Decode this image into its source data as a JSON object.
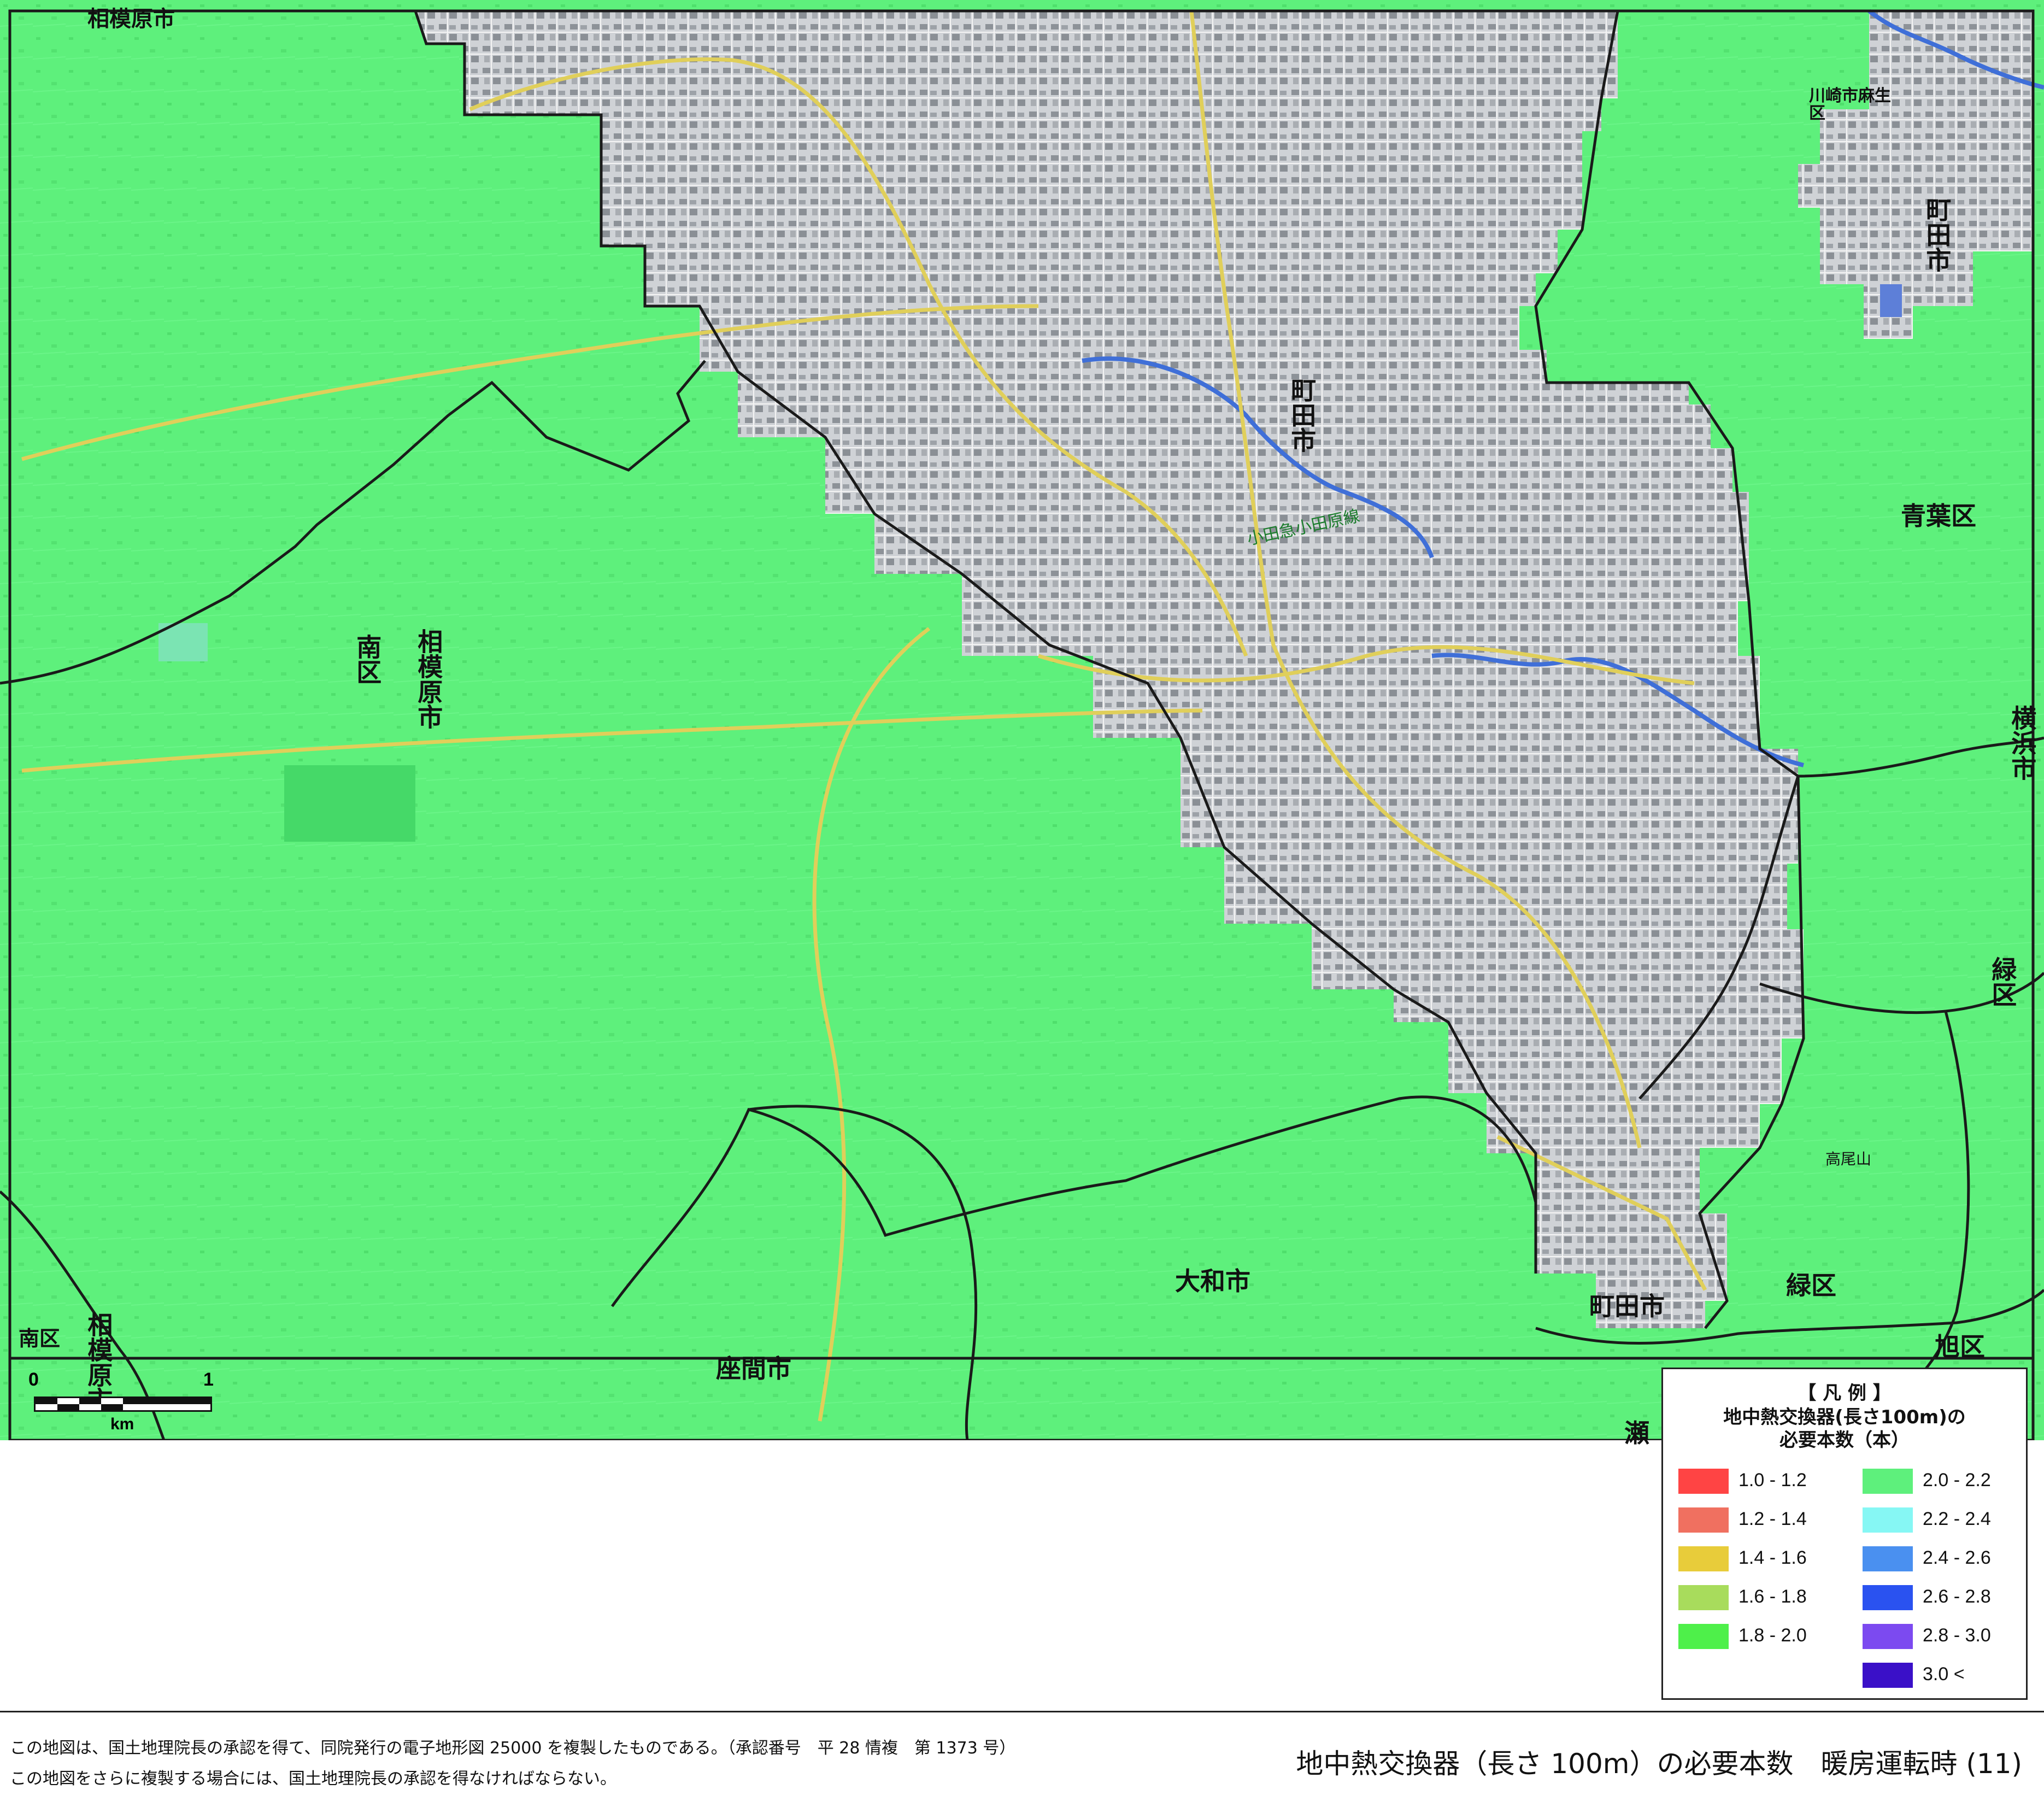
{
  "colors": {
    "green_band": "#5ef07c",
    "urban_gray": "#c9ccd0",
    "boundary": "#1a1a1a",
    "river": "#3f6fd8",
    "road": "#e0cf5a"
  },
  "map": {
    "place_labels": [
      {
        "text": "相模原市",
        "vertical": false
      },
      {
        "text": "町田市",
        "vertical": true
      },
      {
        "text": "川崎市麻生区",
        "vertical": false
      },
      {
        "text": "町田市",
        "vertical": true
      },
      {
        "text": "青葉区",
        "vertical": false
      },
      {
        "text": "横浜市",
        "vertical": true
      },
      {
        "text": "南区",
        "vertical": true
      },
      {
        "text": "相模原市",
        "vertical": true
      },
      {
        "text": "緑区",
        "vertical": true
      },
      {
        "text": "大和市",
        "vertical": false
      },
      {
        "text": "町田市",
        "vertical": false
      },
      {
        "text": "緑区",
        "vertical": false
      },
      {
        "text": "旭区",
        "vertical": false
      },
      {
        "text": "座間市",
        "vertical": false
      },
      {
        "text": "瀬",
        "vertical": false
      },
      {
        "text": "相模原市",
        "vertical": true
      },
      {
        "text": "南区",
        "vertical": false
      },
      {
        "text": "高尾山",
        "vertical": false
      }
    ],
    "route_label": "小田急小田原線"
  },
  "scale_bar": {
    "zero": "0",
    "one": "1",
    "unit": "km"
  },
  "legend": {
    "heading": "【 凡 例 】",
    "title_line1": "地中熱交換器(長さ100m)の",
    "title_line2": "必要本数（本）",
    "items": [
      {
        "label": "1.0 - 1.2",
        "color": "#ff4444"
      },
      {
        "label": "1.2 - 1.4",
        "color": "#f07060"
      },
      {
        "label": "1.4 - 1.6",
        "color": "#e8cc3a"
      },
      {
        "label": "1.6 - 1.8",
        "color": "#a8dc5c"
      },
      {
        "label": "1.8 - 2.0",
        "color": "#4ef04a"
      },
      {
        "label": "2.0 - 2.2",
        "color": "#5ef07c"
      },
      {
        "label": "2.2 - 2.4",
        "color": "#86f7f4"
      },
      {
        "label": "2.4 - 2.6",
        "color": "#4a90f0"
      },
      {
        "label": "2.6 - 2.8",
        "color": "#2a52f0"
      },
      {
        "label": "2.8 - 3.0",
        "color": "#7c4af0"
      },
      {
        "label": "3.0 <",
        "color": "#3a10c8"
      }
    ]
  },
  "footer": {
    "note1": "この地図は、国土地理院長の承認を得て、同院発行の電子地形図 25000 を複製したものである。（承認番号　平 28 情複　第 1373 号）",
    "note2": "この地図をさらに複製する場合には、国土地理院長の承認を得なければならない。",
    "title": "地中熱交換器（長さ 100m）の必要本数　暖房運転時 (11)"
  }
}
